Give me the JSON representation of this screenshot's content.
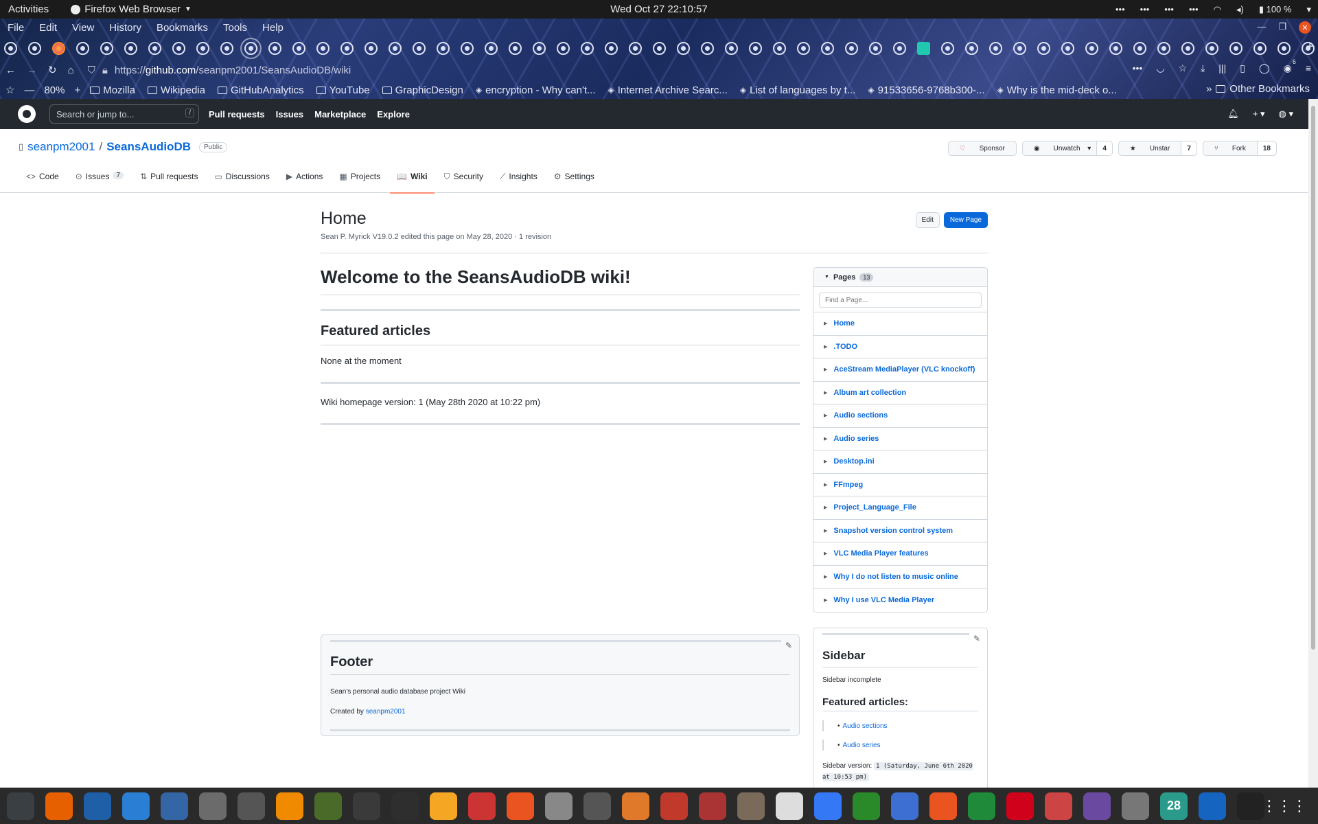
{
  "topbar": {
    "activities": "Activities",
    "app": "Firefox Web Browser",
    "clock": "Wed Oct 27  22:10:57",
    "battery": "100 %"
  },
  "menubar": [
    "File",
    "Edit",
    "View",
    "History",
    "Bookmarks",
    "Tools",
    "Help"
  ],
  "tabs": {
    "count": 55,
    "active_index": 10,
    "firefox_index": 2,
    "special_index": 38
  },
  "navbar": {
    "url_prefix": "https://",
    "url_host": "github.com",
    "url_path": "/seanpm2001/SeansAudioDB/wiki",
    "zoom": "80%",
    "extension_badge": "6"
  },
  "bookmarks": [
    {
      "label": "Mozilla",
      "type": "folder"
    },
    {
      "label": "Wikipedia",
      "type": "folder"
    },
    {
      "label": "GitHubAnalytics",
      "type": "folder"
    },
    {
      "label": "YouTube",
      "type": "folder"
    },
    {
      "label": "GraphicDesign",
      "type": "folder"
    },
    {
      "label": "encryption - Why can't...",
      "type": "link"
    },
    {
      "label": "Internet Archive Searc...",
      "type": "link"
    },
    {
      "label": "List of languages by t...",
      "type": "link"
    },
    {
      "label": "91533656-9768b300-...",
      "type": "link"
    },
    {
      "label": "Why is the mid-deck o...",
      "type": "link"
    }
  ],
  "other_bookmarks": "Other Bookmarks",
  "github": {
    "search_placeholder": "Search or jump to...",
    "search_key": "/",
    "nav": [
      "Pull requests",
      "Issues",
      "Marketplace",
      "Explore"
    ]
  },
  "repo": {
    "owner": "seanpm2001",
    "name": "SeansAudioDB",
    "visibility": "Public",
    "sponsor": "Sponsor",
    "unwatch": "Unwatch",
    "watch_count": "4",
    "unstar": "Unstar",
    "star_count": "7",
    "fork": "Fork",
    "fork_count": "18",
    "tabs": [
      {
        "label": "Code",
        "icon": "<>"
      },
      {
        "label": "Issues",
        "icon": "⊙",
        "count": "7"
      },
      {
        "label": "Pull requests",
        "icon": "⇅"
      },
      {
        "label": "Discussions",
        "icon": "▭"
      },
      {
        "label": "Actions",
        "icon": "▶"
      },
      {
        "label": "Projects",
        "icon": "▦"
      },
      {
        "label": "Wiki",
        "icon": "📖"
      },
      {
        "label": "Security",
        "icon": "⛉"
      },
      {
        "label": "Insights",
        "icon": "⟋"
      },
      {
        "label": "Settings",
        "icon": "⚙"
      }
    ],
    "active_tab": "Wiki"
  },
  "wiki": {
    "title": "Home",
    "meta": "Sean P. Myrick V19.0.2 edited this page on May 28, 2020 · 1 revision",
    "edit": "Edit",
    "new_page": "New Page",
    "h1": "Welcome to the SeansAudioDB wiki!",
    "featured_heading": "Featured articles",
    "featured_text": "None at the moment",
    "version_text": "Wiki homepage version: 1 (May 28th 2020 at 10:22 pm)",
    "footer": {
      "title": "Footer",
      "line1": "Sean's personal audio database project Wiki",
      "created_prefix": "Created by ",
      "created_link": "seanpm2001"
    }
  },
  "pages": {
    "heading": "Pages",
    "count": "13",
    "find_placeholder": "Find a Page...",
    "items": [
      "Home",
      ".TODO",
      "AceStream MediaPlayer (VLC knockoff)",
      "Album art collection",
      "Audio sections",
      "Audio series",
      "Desktop.ini",
      "FFmpeg",
      "Project_Language_File",
      "Snapshot version control system",
      "VLC Media Player features",
      "Why I do not listen to music online",
      "Why I use VLC Media Player"
    ]
  },
  "sidebar": {
    "title": "Sidebar",
    "text": "Sidebar incomplete",
    "featured": "Featured articles:",
    "items": [
      "Audio sections",
      "Audio series"
    ],
    "version_label": "Sidebar version: ",
    "version_code": "1 (Saturday, June 6th 2020 at 10:53 pm)"
  },
  "dock": {
    "calendar_day": "28",
    "apps": [
      "system-monitor-icon",
      "firefox-icon",
      "text-editor-icon",
      "help-icon",
      "writer-icon",
      "files-icon",
      "settings-icon",
      "vlc-icon",
      "gimp-icon",
      "inkscape-icon",
      "terminal-icon",
      "calculator-icon",
      "sound-recorder-icon",
      "software-center-icon",
      "image-viewer-icon",
      "disk-usage-icon",
      "libreoffice-draw-icon",
      "document-scanner-icon",
      "pdf-viewer-icon",
      "archive-manager-icon",
      "character-map-icon",
      "tasks-icon",
      "vim-icon",
      "virtual-machine-icon",
      "updater-icon",
      "spreadsheet-icon",
      "alert-icon",
      "mario-game-icon",
      "webcam-icon",
      "gnome-game-icon",
      "calendar-icon",
      "thunderbird-icon",
      "music-icon"
    ]
  }
}
